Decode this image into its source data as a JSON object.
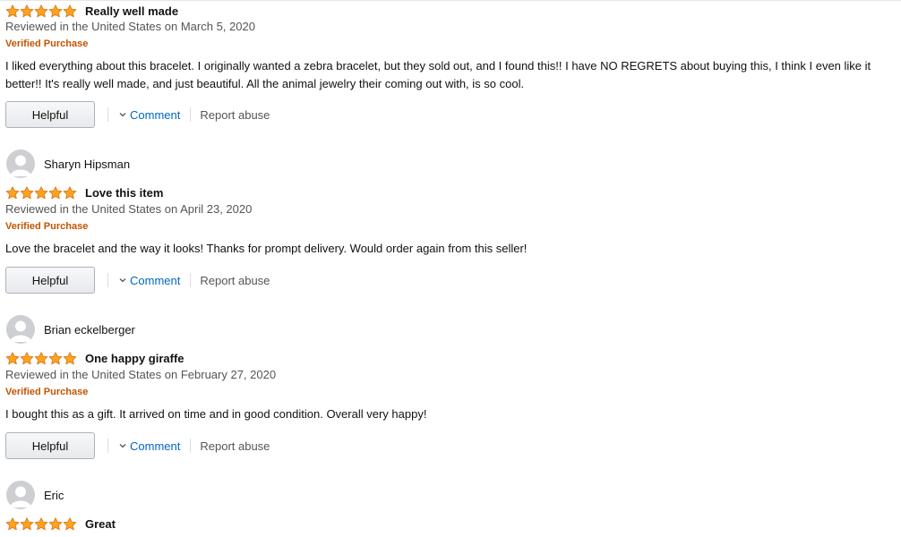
{
  "reviews": [
    {
      "profile_name": "",
      "rating": 5,
      "title": "Really well made",
      "date": "Reviewed in the United States on March 5, 2020",
      "badge": "Verified Purchase",
      "body": "I liked everything about this bracelet. I originally wanted a zebra bracelet, but they sold out, and I found this!! I have NO REGRETS about buying this, I think I even like it better!! It's really well made, and just beautiful. All the animal jewelry their coming out with, is so cool.",
      "helpful_label": "Helpful",
      "comment_label": "Comment",
      "report_label": "Report abuse"
    },
    {
      "profile_name": "Sharyn Hipsman",
      "rating": 5,
      "title": "Love this item",
      "date": "Reviewed in the United States on April 23, 2020",
      "badge": "Verified Purchase",
      "body": "Love the bracelet and the way it looks! Thanks for prompt delivery. Would order again from this seller!",
      "helpful_label": "Helpful",
      "comment_label": "Comment",
      "report_label": "Report abuse"
    },
    {
      "profile_name": "Brian eckelberger",
      "rating": 5,
      "title": "One happy giraffe",
      "date": "Reviewed in the United States on February 27, 2020",
      "badge": "Verified Purchase",
      "body": "I bought this as a gift. It arrived on time and in good condition. Overall very happy!",
      "helpful_label": "Helpful",
      "comment_label": "Comment",
      "report_label": "Report abuse"
    },
    {
      "profile_name": "Eric",
      "rating": 5,
      "title": "Great"
    }
  ],
  "icons": {
    "star": "star-icon",
    "avatar": "avatar-icon",
    "chevron": "chevron-down-icon"
  },
  "colors": {
    "star_fill": "#ffa41c",
    "star_stroke": "#de7921",
    "verified": "#c45500",
    "link": "#0066c0",
    "muted": "#555555"
  }
}
